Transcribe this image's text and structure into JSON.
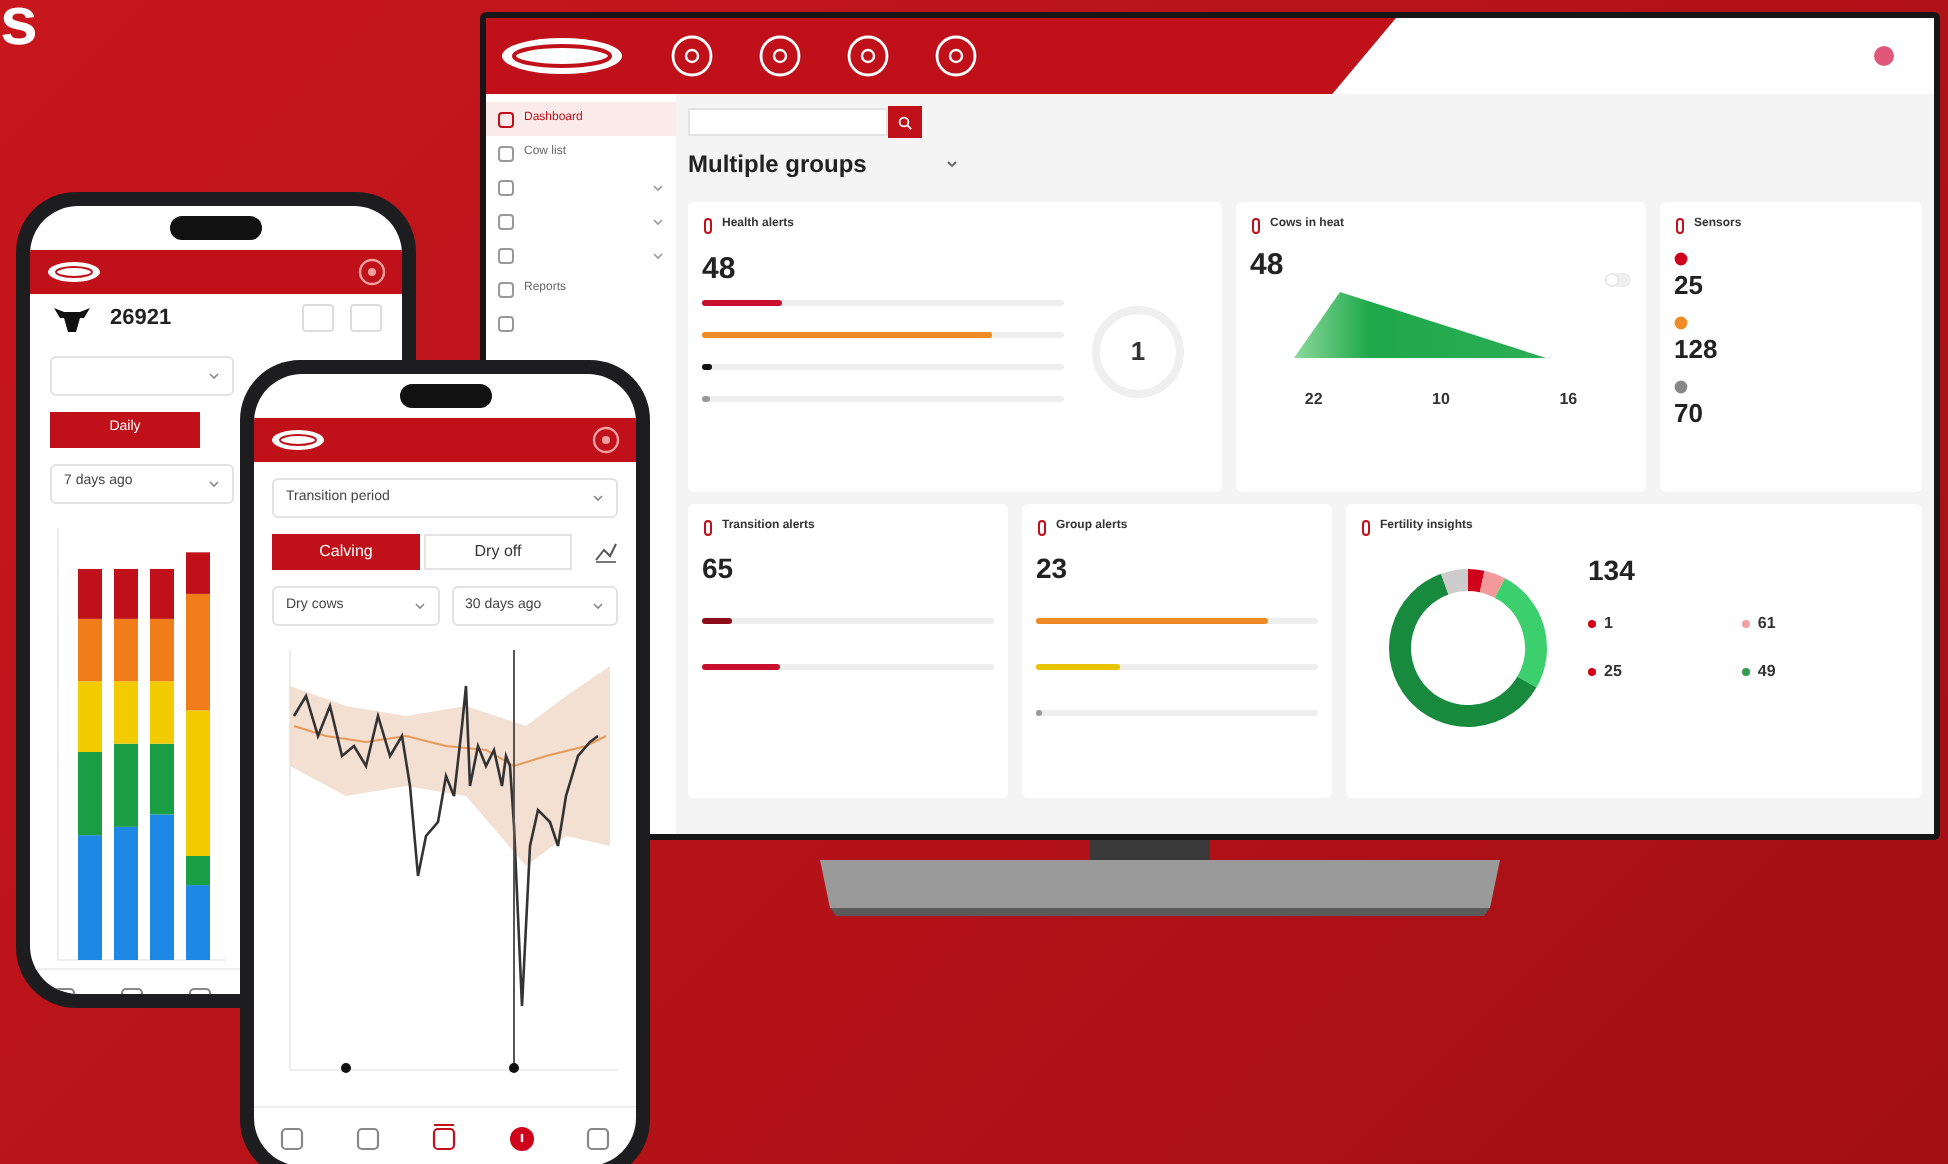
{
  "heading": {
    "text": "s"
  },
  "tv": {
    "sidebar": [
      {
        "label": "Dashboard",
        "selected": true,
        "expandable": false
      },
      {
        "label": "Cow list",
        "selected": false,
        "expandable": false
      },
      {
        "selected": false,
        "expandable": true
      },
      {
        "selected": false,
        "expandable": true
      },
      {
        "selected": false,
        "expandable": true
      },
      {
        "label": "Reports",
        "selected": false,
        "expandable": false
      },
      {
        "selected": false,
        "expandable": false
      }
    ],
    "page_title": "Multiple groups",
    "health_alerts": {
      "title": "Health alerts",
      "total": "48",
      "rows": [
        {
          "level": 0.22,
          "color": "#c8102e"
        },
        {
          "level": 0.8,
          "color": "#f08a24"
        },
        {
          "level": 0.03,
          "color": "#111111"
        },
        {
          "level": 0.02,
          "color": "#999999"
        }
      ],
      "gauge": "1"
    },
    "cows_in_heat": {
      "title": "Cows in heat",
      "total": "48",
      "toggle": {
        "on": false
      },
      "stats": [
        "22",
        "10",
        "16"
      ]
    },
    "sensors": {
      "title": "Sensors",
      "items": [
        {
          "value": "25",
          "color": "#d0021b"
        },
        {
          "value": "128",
          "color": "#f08a24"
        },
        {
          "value": "70",
          "color": "#888888"
        }
      ]
    },
    "transition_alerts": {
      "title": "Transition alerts",
      "total": "65",
      "rows": [
        {
          "level": 0.1,
          "color": "#8b0d1a"
        },
        {
          "level": 0.27,
          "color": "#c8102e"
        }
      ]
    },
    "group_alerts": {
      "title": "Group alerts",
      "total": "23",
      "rows": [
        {
          "level": 0.82,
          "color": "#f08a24"
        },
        {
          "level": 0.3,
          "color": "#e8c400"
        },
        {
          "level": 0.02,
          "color": "#999999"
        }
      ]
    },
    "fertility": {
      "title": "Fertility insights",
      "total": "134",
      "legend": [
        {
          "value": "1",
          "color": "#d0021b"
        },
        {
          "value": "61",
          "color": "#f4a0a0"
        },
        {
          "value": "25",
          "color": "#d0021b"
        },
        {
          "value": "49",
          "color": "#2e9e4f"
        }
      ]
    }
  },
  "phone_back": {
    "animal": "26921",
    "tabs": [
      {
        "label": "Daily",
        "selected": true
      }
    ],
    "period": "7 days ago"
  },
  "phone_front": {
    "dropdown": "Transition period",
    "tabs": [
      {
        "label": "Calving",
        "selected": true
      },
      {
        "label": "Dry off",
        "selected": false
      }
    ],
    "filters": [
      "Dry cows",
      "30 days ago"
    ],
    "nav": [
      {
        "kind": "tab",
        "selected": false
      },
      {
        "kind": "tab",
        "selected": false
      },
      {
        "kind": "tab",
        "selected": true
      },
      {
        "kind": "alert",
        "selected": false
      },
      {
        "kind": "tab",
        "selected": false
      }
    ]
  }
}
